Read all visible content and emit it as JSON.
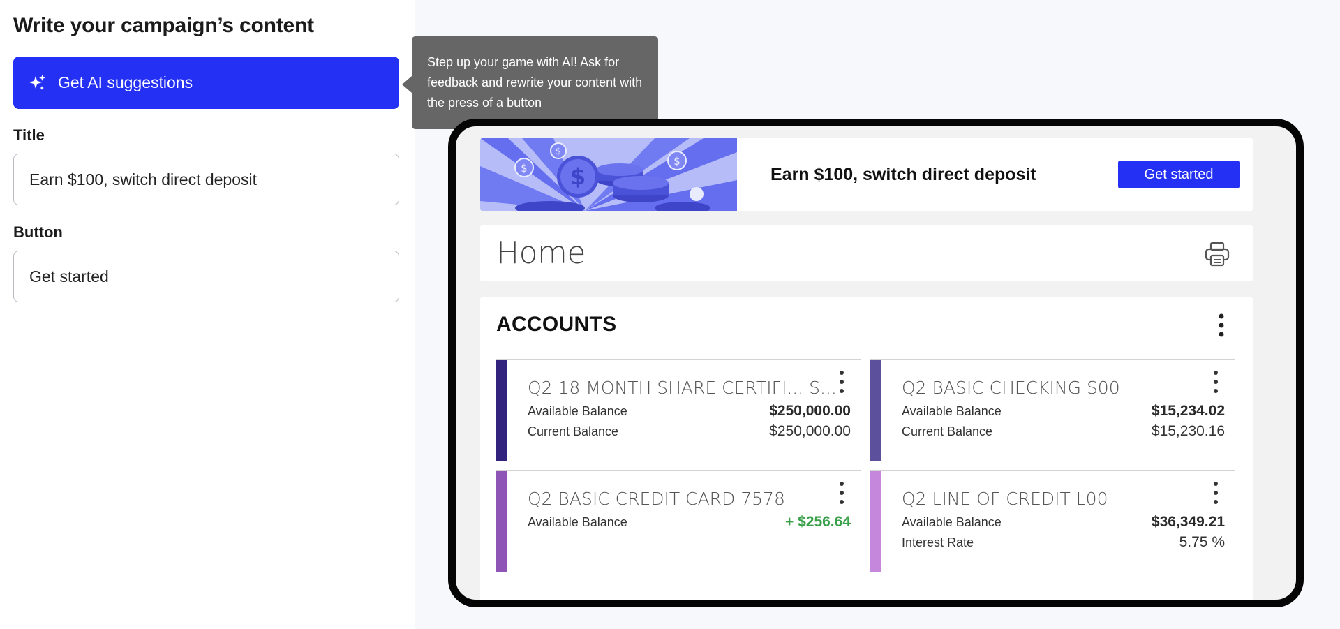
{
  "editor": {
    "heading": "Write your campaign’s content",
    "ai_button_label": "Get AI suggestions",
    "title_label": "Title",
    "title_value": "Earn $100, switch direct deposit",
    "button_label": "Button",
    "button_value": "Get started"
  },
  "tooltip": {
    "text": "Step up your game with AI! Ask for feedback and rewrite your content with the press of a button"
  },
  "preview": {
    "banner": {
      "title": "Earn $100, switch direct deposit",
      "button": "Get started"
    },
    "home_title": "Home",
    "accounts_title": "ACCOUNTS",
    "accounts": [
      {
        "name": "Q2 18 MONTH SHARE CERTIFI...  S...",
        "stripe_color": "#32237f",
        "rows": [
          {
            "label": "Available Balance",
            "value": "$250,000.00",
            "style": "bold"
          },
          {
            "label": "Current Balance",
            "value": "$250,000.00",
            "style": "normal"
          }
        ]
      },
      {
        "name": "Q2 BASIC CHECKING S00",
        "stripe_color": "#5c4f9c",
        "rows": [
          {
            "label": "Available Balance",
            "value": "$15,234.02",
            "style": "bold"
          },
          {
            "label": "Current Balance",
            "value": "$15,230.16",
            "style": "normal"
          }
        ]
      },
      {
        "name": "Q2 BASIC CREDIT CARD 7578",
        "stripe_color": "#8e55b6",
        "rows": [
          {
            "label": "Available Balance",
            "value": "+ $256.64",
            "style": "green"
          }
        ]
      },
      {
        "name": "Q2 LINE OF CREDIT L00",
        "stripe_color": "#c487dc",
        "rows": [
          {
            "label": "Available Balance",
            "value": "$36,349.21",
            "style": "bold"
          },
          {
            "label": "Interest Rate",
            "value": "5.75 %",
            "style": "normal"
          }
        ]
      }
    ]
  },
  "colors": {
    "brand": "#2430f3",
    "tooltip_bg": "#666666",
    "positive": "#3aa14a"
  },
  "icons": {
    "ai_button": "sparkle-icon",
    "home": "printer-icon",
    "menus": "more-vertical-icon"
  }
}
